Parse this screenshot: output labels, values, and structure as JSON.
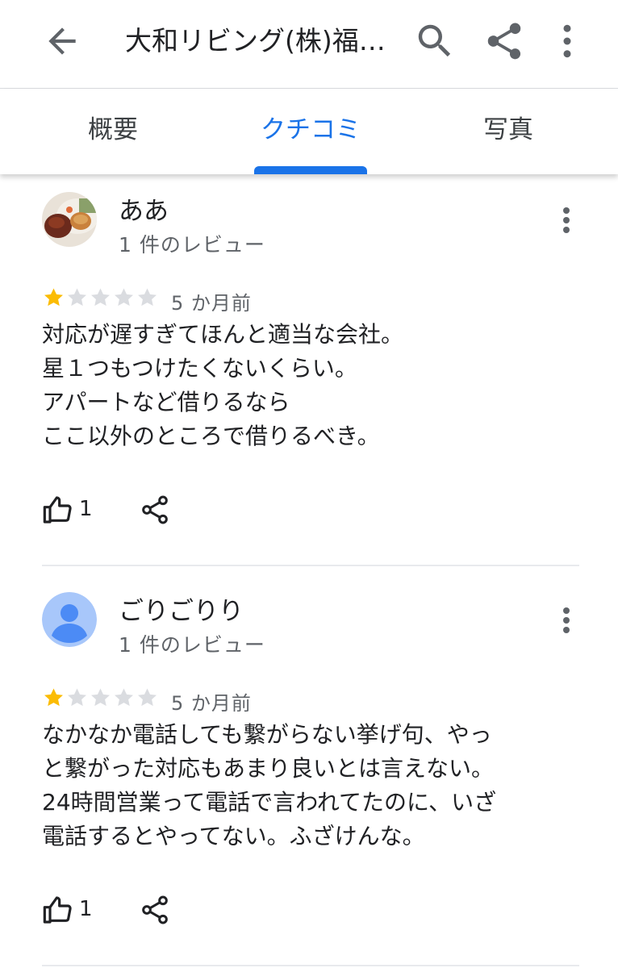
{
  "header": {
    "title": "大和リビング(株)福…",
    "back_icon": "arrow-back-icon",
    "search_icon": "search-icon",
    "share_icon": "share-icon",
    "more_icon": "more-vert-icon"
  },
  "tabs": [
    {
      "label": "概要",
      "selected": false
    },
    {
      "label": "クチコミ",
      "selected": true
    },
    {
      "label": "写真",
      "selected": false
    }
  ],
  "colors": {
    "accent": "#1a73e8",
    "star_filled": "#fbbc04",
    "star_empty": "#dadce0"
  },
  "reviews": [
    {
      "name": "ああ",
      "review_count": "1 件のレビュー",
      "rating": 1,
      "max_rating": 5,
      "age": "5 か月前",
      "text": "対応が遅すぎてほんと適当な会社。\n星１つもつけたくないくらい。\nアパートなど借りるなら\nここ以外のところで借りるべき。",
      "likes": "1",
      "avatar": "food-photo-avatar"
    },
    {
      "name": "ごりごりり",
      "review_count": "1 件のレビュー",
      "rating": 1,
      "max_rating": 5,
      "age": "5 か月前",
      "text": "なかなか電話しても繋がらない挙げ句、やっ\nと繋がった対応もあまり良いとは言えない。\n24時間営業って電話で言われてたのに、いざ\n電話するとやってない。ふざけんな。",
      "likes": "1",
      "avatar": "default-person-avatar"
    }
  ]
}
